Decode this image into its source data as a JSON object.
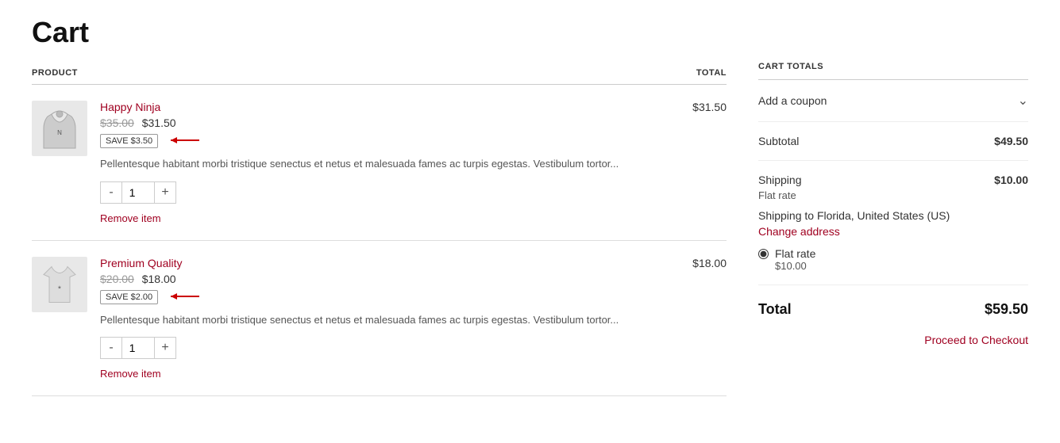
{
  "page": {
    "title": "Cart"
  },
  "table": {
    "col_product": "PRODUCT",
    "col_total": "TOTAL"
  },
  "items": [
    {
      "id": "item-1",
      "name": "Happy Ninja",
      "original_price": "$35.00",
      "sale_price": "$31.50",
      "save_label": "SAVE $3.50",
      "description": "Pellentesque habitant morbi tristique senectus et netus et malesuada fames ac turpis egestas. Vestibulum tortor...",
      "qty": "1",
      "total": "$31.50",
      "remove_label": "Remove item"
    },
    {
      "id": "item-2",
      "name": "Premium Quality",
      "original_price": "$20.00",
      "sale_price": "$18.00",
      "save_label": "SAVE $2.00",
      "description": "Pellentesque habitant morbi tristique senectus et netus et malesuada fames ac turpis egestas. Vestibulum tortor...",
      "qty": "1",
      "total": "$18.00",
      "remove_label": "Remove item"
    }
  ],
  "sidebar": {
    "title": "CART TOTALS",
    "coupon_label": "Add a coupon",
    "subtotal_label": "Subtotal",
    "subtotal_value": "$49.50",
    "shipping_label": "Shipping",
    "shipping_value": "$10.00",
    "flat_rate_note": "Flat rate",
    "shipping_to_text": "Shipping to Florida, United States (US)",
    "change_address_label": "Change address",
    "radio_label": "Flat rate",
    "radio_sub": "$10.00",
    "total_label": "Total",
    "total_value": "$59.50",
    "checkout_label": "Proceed to Checkout",
    "qty_minus": "-",
    "qty_plus": "+"
  }
}
